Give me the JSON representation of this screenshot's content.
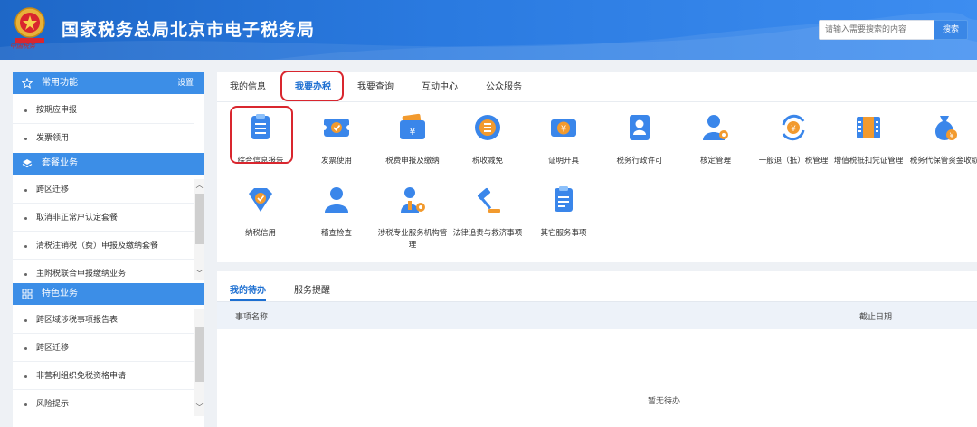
{
  "header": {
    "emblem_text": "中国税务",
    "title": "国家税务总局北京市电子税务局",
    "search_placeholder": "请输入需要搜索的内容",
    "search_button": "搜索"
  },
  "sidebar": {
    "sections": [
      {
        "icon": "star-icon",
        "title": "常用功能",
        "action": "设置",
        "items": [
          "按期应申报",
          "发票领用"
        ]
      },
      {
        "icon": "layers-icon",
        "title": "套餐业务",
        "items": [
          "跨区迁移",
          "取消非正常户认定套餐",
          "清税注销税（费）申报及缴纳套餐",
          "主附税联合申报缴纳业务"
        ]
      },
      {
        "icon": "grid-icon",
        "title": "特色业务",
        "items": [
          "跨区域涉税事项报告表",
          "跨区迁移",
          "非营利组织免税资格申请",
          "风险提示"
        ]
      }
    ]
  },
  "main": {
    "tabs": [
      "我的信息",
      "我要办税",
      "我要查询",
      "互动中心",
      "公众服务"
    ],
    "active_tab": "我要办税",
    "services": [
      {
        "label": "综合信息报告",
        "icon": "clipboard-icon"
      },
      {
        "label": "发票使用",
        "icon": "invoice-check-icon"
      },
      {
        "label": "税费申报及缴纳",
        "icon": "wallet-yuan-icon"
      },
      {
        "label": "税收减免",
        "icon": "coin-stack-icon"
      },
      {
        "label": "证明开具",
        "icon": "yuan-ticket-icon"
      },
      {
        "label": "税务行政许可",
        "icon": "id-card-icon"
      },
      {
        "label": "核定管理",
        "icon": "user-gear-icon"
      },
      {
        "label": "一般退（抵）税管理",
        "icon": "yuan-refresh-icon"
      },
      {
        "label": "增值税抵扣凭证管理",
        "icon": "vat-book-icon"
      },
      {
        "label": "税务代保管资金收取",
        "icon": "money-bag-icon"
      },
      {
        "label": "纳税信用",
        "icon": "diamond-shield-icon"
      },
      {
        "label": "稽查检查",
        "icon": "user-icon"
      },
      {
        "label": "涉税专业服务机构管理",
        "icon": "person-gear-icon"
      },
      {
        "label": "法律追责与救济事项",
        "icon": "gavel-icon"
      },
      {
        "label": "其它服务事项",
        "icon": "list-doc-icon"
      }
    ]
  },
  "todo": {
    "tabs": [
      "我的待办",
      "服务提醒"
    ],
    "active_tab": "我的待办",
    "columns": [
      "事项名称",
      "截止日期"
    ],
    "empty_text": "暂无待办"
  },
  "colors": {
    "header_blue": "#2a7ae0",
    "section_blue": "#3c8ee7",
    "active_tab": "#1d6fd1",
    "annotation_red": "#d9262e",
    "icon_blue": "#3a86ea",
    "icon_orange": "#f29a2e"
  }
}
